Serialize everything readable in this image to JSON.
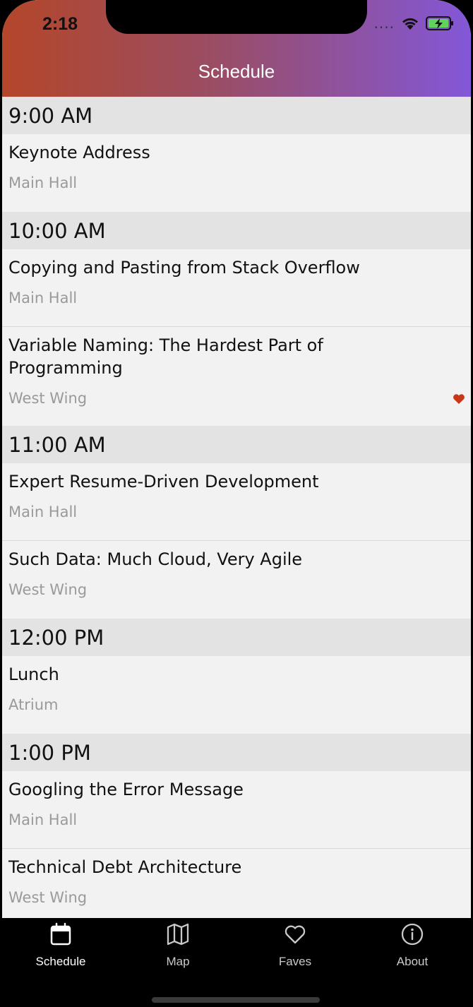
{
  "status": {
    "time": "2:18",
    "signal": "....",
    "icons": [
      "wifi-icon",
      "battery-charging-icon"
    ]
  },
  "header": {
    "title": "Schedule"
  },
  "colors": {
    "accent_start": "#b4462a",
    "accent_end": "#8357d8",
    "favorite": "#c9371a"
  },
  "groups": [
    {
      "time": "9:00 AM",
      "sessions": [
        {
          "title": "Keynote Address",
          "room": "Main Hall",
          "favorite": false
        }
      ]
    },
    {
      "time": "10:00 AM",
      "sessions": [
        {
          "title": "Copying and Pasting from Stack Overflow",
          "room": "Main Hall",
          "favorite": false
        },
        {
          "title": "Variable Naming: The Hardest Part of Programming",
          "room": "West Wing",
          "favorite": true
        }
      ]
    },
    {
      "time": "11:00 AM",
      "sessions": [
        {
          "title": "Expert Resume-Driven Development",
          "room": "Main Hall",
          "favorite": false
        },
        {
          "title": "Such Data: Much Cloud, Very Agile",
          "room": "West Wing",
          "favorite": false
        }
      ]
    },
    {
      "time": "12:00 PM",
      "sessions": [
        {
          "title": "Lunch",
          "room": "Atrium",
          "favorite": false
        }
      ]
    },
    {
      "time": "1:00 PM",
      "sessions": [
        {
          "title": "Googling the Error Message",
          "room": "Main Hall",
          "favorite": false
        },
        {
          "title": "Technical Debt Architecture",
          "room": "West Wing",
          "favorite": false
        }
      ]
    }
  ],
  "tabs": [
    {
      "label": "Schedule",
      "icon": "calendar-icon",
      "active": true
    },
    {
      "label": "Map",
      "icon": "map-icon",
      "active": false
    },
    {
      "label": "Faves",
      "icon": "heart-icon",
      "active": false
    },
    {
      "label": "About",
      "icon": "info-icon",
      "active": false
    }
  ]
}
